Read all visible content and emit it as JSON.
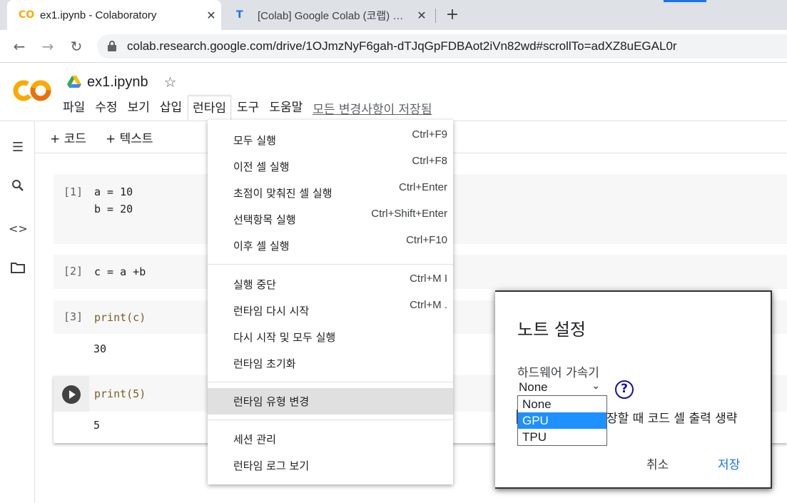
{
  "browser": {
    "tabs": [
      {
        "title": "ex1.ipynb - Colaboratory",
        "favicon": "CO",
        "favicon_color": "#f9ab00"
      },
      {
        "title": "[Colab] Google Colab (코랩) 환경",
        "favicon": "T",
        "favicon_color": "#1a73e8"
      }
    ],
    "new_tab": "+",
    "close": "✕",
    "url": "colab.research.google.com/drive/1OJmzNyF6gah-dTJqGpFDBAot2iVn82wd#scrollTo=adXZ8uEGAL0r"
  },
  "colab": {
    "notebook_title": "ex1.ipynb",
    "menus": [
      "파일",
      "수정",
      "보기",
      "삽입",
      "런타임",
      "도구",
      "도움말"
    ],
    "save_status": "모든 변경사항이 저장됨",
    "toolbar": {
      "add_code": "+ 코드",
      "add_text": "+ 텍스트"
    }
  },
  "cells": [
    {
      "prompt": "[1]",
      "lines": [
        "a = 10",
        "b = 20"
      ]
    },
    {
      "prompt": "[2]",
      "lines": [
        "c = a +b"
      ]
    },
    {
      "prompt": "[3]",
      "code": "print(c)",
      "output": "30"
    },
    {
      "code": "print(5)",
      "output": "5"
    }
  ],
  "runtime_menu": {
    "items": [
      {
        "label": "모두 실행",
        "shortcut": "Ctrl+F9"
      },
      {
        "label": "이전 셀 실행",
        "shortcut": "Ctrl+F8"
      },
      {
        "label": "초점이 맞춰진 셀 실행",
        "shortcut": "Ctrl+Enter"
      },
      {
        "label": "선택항목 실행",
        "shortcut": "Ctrl+Shift+Enter"
      },
      {
        "label": "이후 셀 실행",
        "shortcut": "Ctrl+F10"
      },
      {
        "label": "실행 중단",
        "shortcut": "Ctrl+M I"
      },
      {
        "label": "런타임 다시 시작",
        "shortcut": "Ctrl+M ."
      },
      {
        "label": "다시 시작 및 모두 실행",
        "shortcut": ""
      },
      {
        "label": "런타임 초기화",
        "shortcut": ""
      },
      {
        "label": "런타임 유형 변경",
        "shortcut": ""
      },
      {
        "label": "세션 관리",
        "shortcut": ""
      },
      {
        "label": "런타임 로그 보기",
        "shortcut": ""
      }
    ]
  },
  "dialog": {
    "title": "노트 설정",
    "hw_label": "하드웨어 가속기",
    "hw_selected": "None",
    "hw_options": [
      "None",
      "GPU",
      "TPU"
    ],
    "omit_label": "장할 때 코드 셀 출력 생략",
    "help": "?",
    "cancel": "취소",
    "save": "저장"
  },
  "colors": {
    "accent": "#1a73e8",
    "highlight": "#1e90ff",
    "logo_orange": "#f9ab00"
  }
}
